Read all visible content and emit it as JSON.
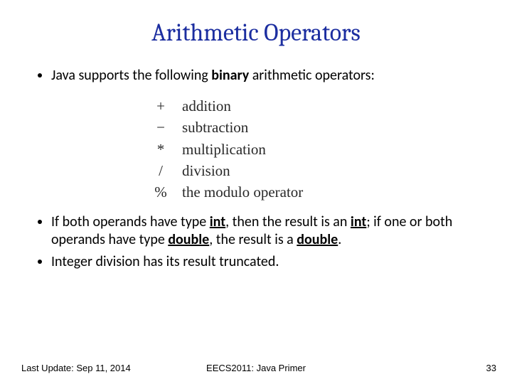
{
  "title": "Arithmetic Operators",
  "bullets": {
    "b1_pre": "Java supports the following ",
    "b1_bold": "binary",
    "b1_post": " arithmetic operators:",
    "b2_a": "If both operands have type ",
    "b2_int1": "int",
    "b2_b": ", then the result is an ",
    "b2_int2": "int",
    "b2_c": "; if one or both operands have type ",
    "b2_dbl1": "double",
    "b2_d": ", the result is a ",
    "b2_dbl2": "double",
    "b2_e": ".",
    "b3": "Integer division has its result truncated."
  },
  "operators": [
    {
      "sym": "+",
      "desc": "addition"
    },
    {
      "sym": "−",
      "desc": "subtraction"
    },
    {
      "sym": "*",
      "desc": "multiplication"
    },
    {
      "sym": "/",
      "desc": "division"
    },
    {
      "sym": "%",
      "desc": "the modulo operator"
    }
  ],
  "footer": {
    "left": "Last Update: Sep 11, 2014",
    "center": "EECS2011: Java Primer",
    "right": "33"
  }
}
